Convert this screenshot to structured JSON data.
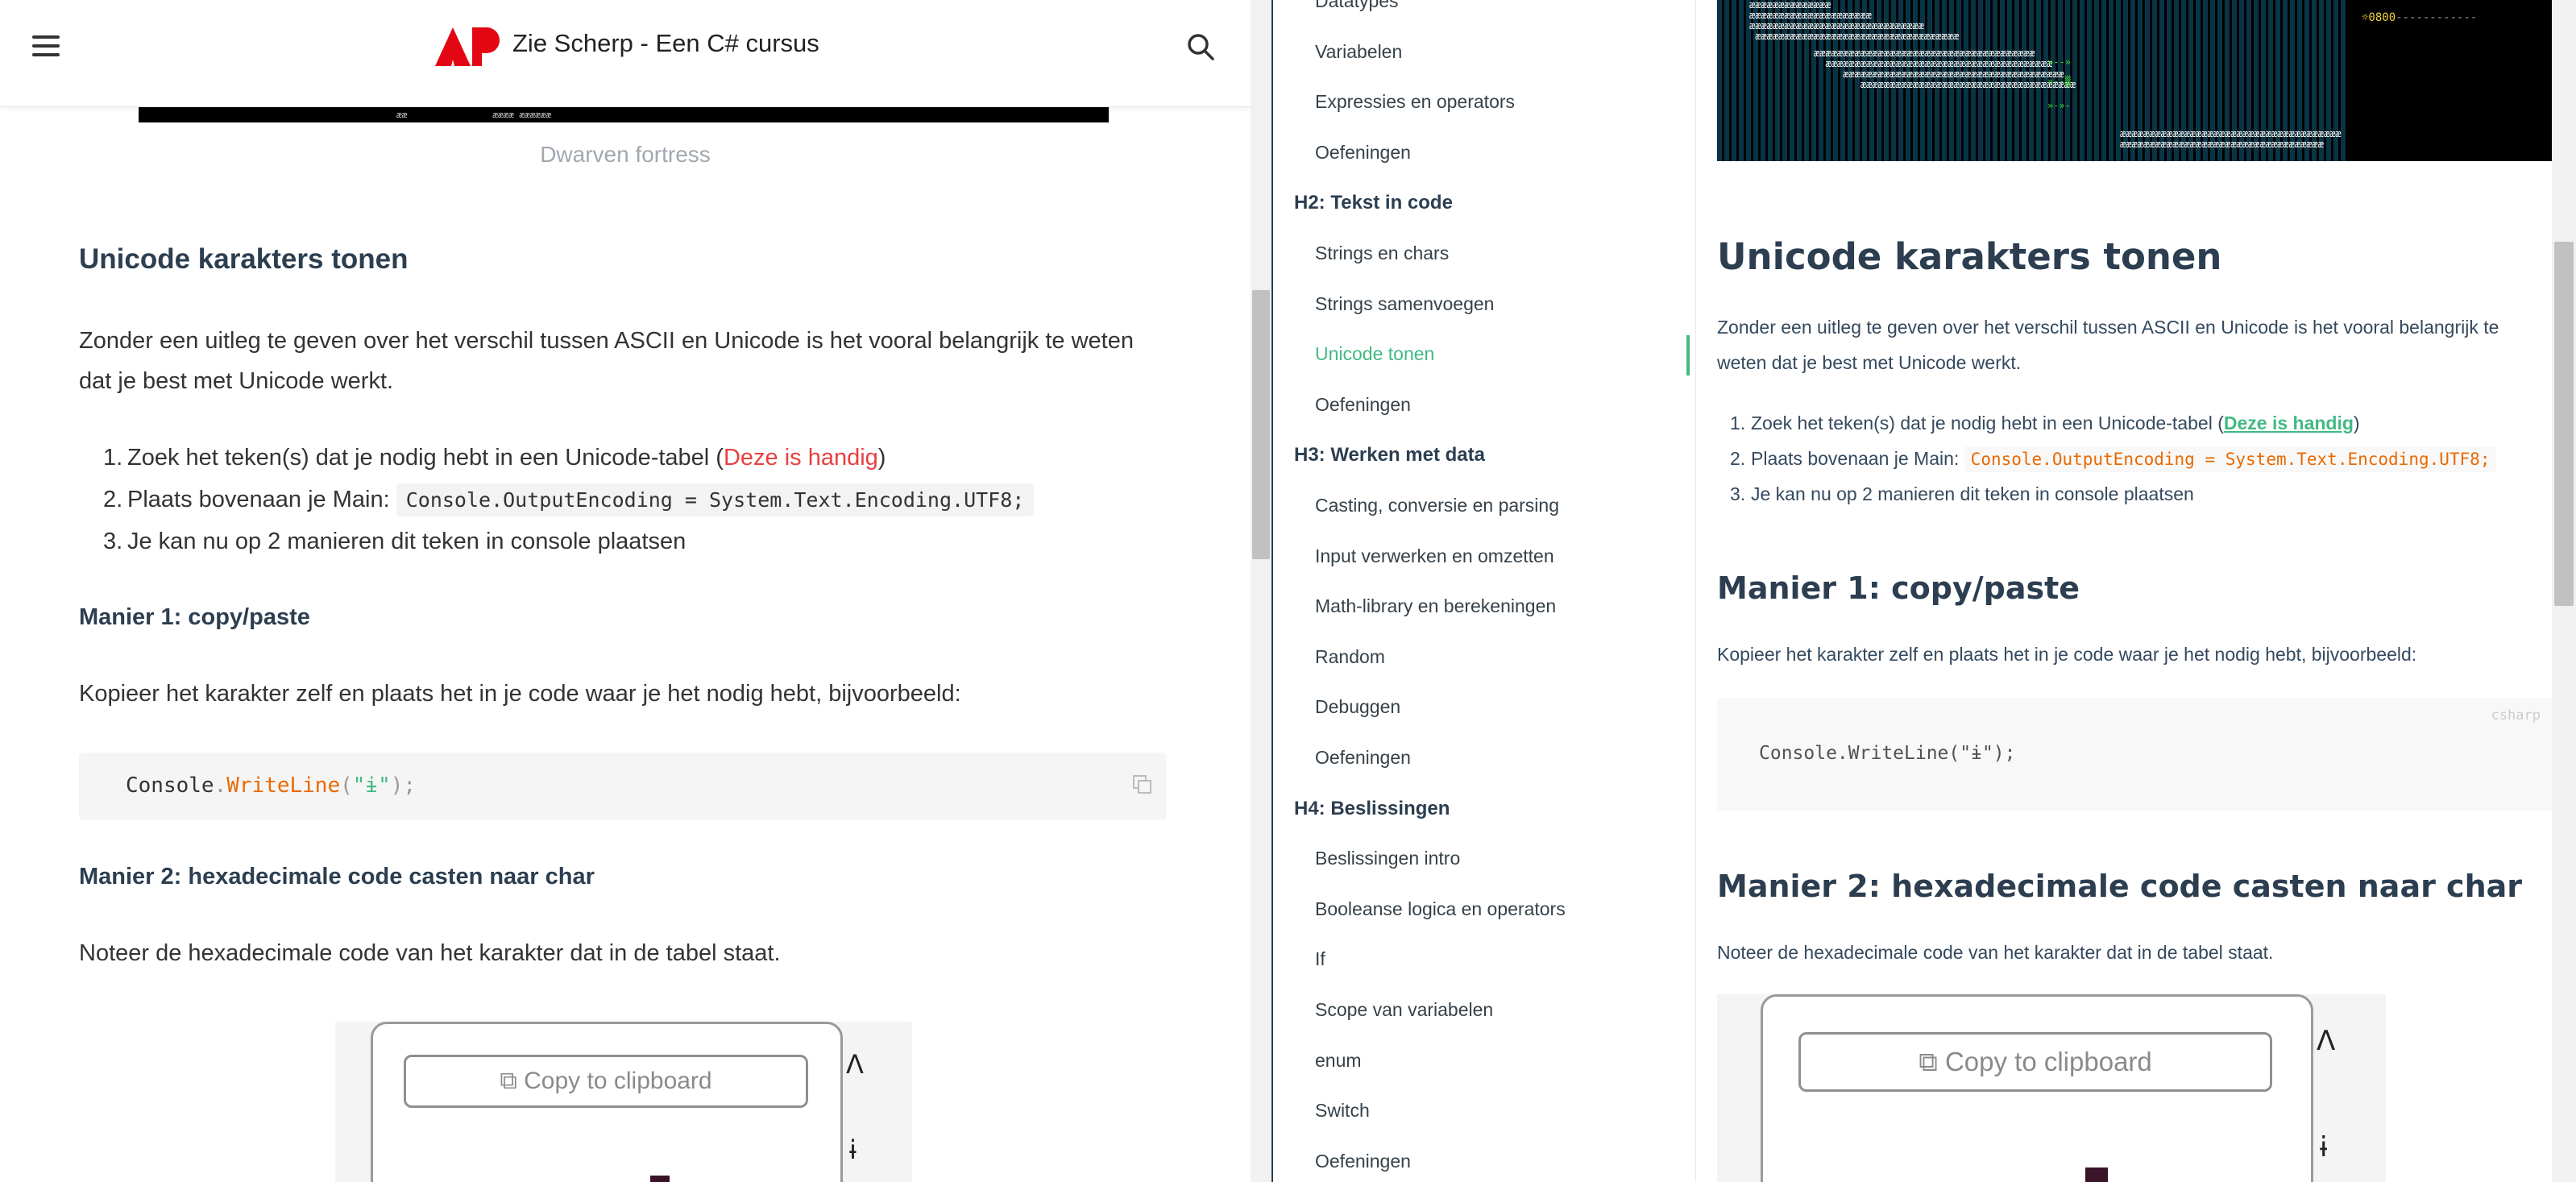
{
  "left": {
    "header": {
      "site_title": "Zie Scherp - Een C# cursus",
      "logo_colors": {
        "primary": "#e30613"
      }
    },
    "image_caption": "Dwarven fortress",
    "df_strip_text": "ææ                ææææ ææææææ",
    "heading": "Unicode karakters tonen",
    "intro": "Zonder een uitleg te geven over het verschil tussen ASCII en Unicode is het vooral belangrijk te weten dat je best met Unicode werkt.",
    "steps": [
      {
        "num": "1.",
        "text_before": "Zoek het teken(s) dat je nodig hebt in een Unicode-tabel (",
        "link": "Deze is handig",
        "text_after": ")"
      },
      {
        "num": "2.",
        "text_before": "Plaats bovenaan je Main: ",
        "code": "Console.OutputEncoding = System.Text.Encoding.UTF8;"
      },
      {
        "num": "3.",
        "text": "Je kan nu op 2 manieren dit teken in console plaatsen"
      }
    ],
    "manier1_title": "Manier 1: copy/paste",
    "manier1_text": "Kopieer het karakter zelf en plaats het in je code waar je het nodig hebt, bijvoorbeeld:",
    "code": {
      "obj": "Console",
      "dot": ".",
      "fn": "WriteLine",
      "open": "(",
      "str": "\"ɨ\"",
      "close": ");"
    },
    "manier2_title": "Manier 2: hexadecimale code casten naar char",
    "manier2_text": "Noteer de hexadecimale code van het karakter dat in de tabel staat.",
    "clipboard_label": "Copy to clipboard",
    "kbd_glyph_1": "Λ",
    "kbd_glyph_2": "ɨ"
  },
  "sidebar": {
    "items": [
      {
        "label": "Datatypes",
        "type": "item"
      },
      {
        "label": "Variabelen",
        "type": "item"
      },
      {
        "label": "Expressies en operators",
        "type": "item"
      },
      {
        "label": "Oefeningen",
        "type": "item"
      },
      {
        "label": "H2: Tekst in code",
        "type": "section"
      },
      {
        "label": "Strings en chars",
        "type": "item"
      },
      {
        "label": "Strings samenvoegen",
        "type": "item"
      },
      {
        "label": "Unicode tonen",
        "type": "item",
        "active": true
      },
      {
        "label": "Oefeningen",
        "type": "item"
      },
      {
        "label": "H3: Werken met data",
        "type": "section"
      },
      {
        "label": "Casting, conversie en parsing",
        "type": "item"
      },
      {
        "label": "Input verwerken en omzetten",
        "type": "item"
      },
      {
        "label": "Math-library en berekeningen",
        "type": "item"
      },
      {
        "label": "Random",
        "type": "item"
      },
      {
        "label": "Debuggen",
        "type": "item"
      },
      {
        "label": "Oefeningen",
        "type": "item"
      },
      {
        "label": "H4: Beslissingen",
        "type": "section"
      },
      {
        "label": "Beslissingen intro",
        "type": "item"
      },
      {
        "label": "Booleanse logica en operators",
        "type": "item"
      },
      {
        "label": "If",
        "type": "item"
      },
      {
        "label": "Scope van variabelen",
        "type": "item"
      },
      {
        "label": "enum",
        "type": "item"
      },
      {
        "label": "Switch",
        "type": "item"
      },
      {
        "label": "Oefeningen",
        "type": "item"
      }
    ],
    "active_color": "#42b983"
  },
  "right": {
    "df_status": "☼0800",
    "df_status_dashes": "------------",
    "df_green_1": "»--»",
    "df_green_2": "»--▒",
    "df_green_3": "»-»-",
    "heading": "Unicode karakters tonen",
    "intro": "Zonder een uitleg te geven over het verschil tussen ASCII en Unicode is het vooral belangrijk te weten dat je best met Unicode werkt.",
    "steps": [
      {
        "num": "1.",
        "text_before": "Zoek het teken(s) dat je nodig hebt in een Unicode-tabel (",
        "link": "Deze is handig",
        "text_after": ")"
      },
      {
        "num": "2.",
        "text_before": "Plaats bovenaan je Main: ",
        "code": "Console.OutputEncoding = System.Text.Encoding.UTF8;"
      },
      {
        "num": "3.",
        "text": "Je kan nu op 2 manieren dit teken in console plaatsen"
      }
    ],
    "manier1_title": "Manier 1: copy/paste",
    "manier1_text": "Kopieer het karakter zelf en plaats het in je code waar je het nodig hebt, bijvoorbeeld:",
    "code_lang": "csharp",
    "code": "Console.WriteLine(\"ɨ\");",
    "manier2_title": "Manier 2: hexadecimale code casten naar char",
    "manier2_text": "Noteer de hexadecimale code van het karakter dat in de tabel staat.",
    "clipboard_label": "Copy to clipboard",
    "kbd_glyph_1": "Λ",
    "kbd_glyph_2": "ɨ",
    "link_color": "#42b983",
    "code_color": "#e96900"
  }
}
